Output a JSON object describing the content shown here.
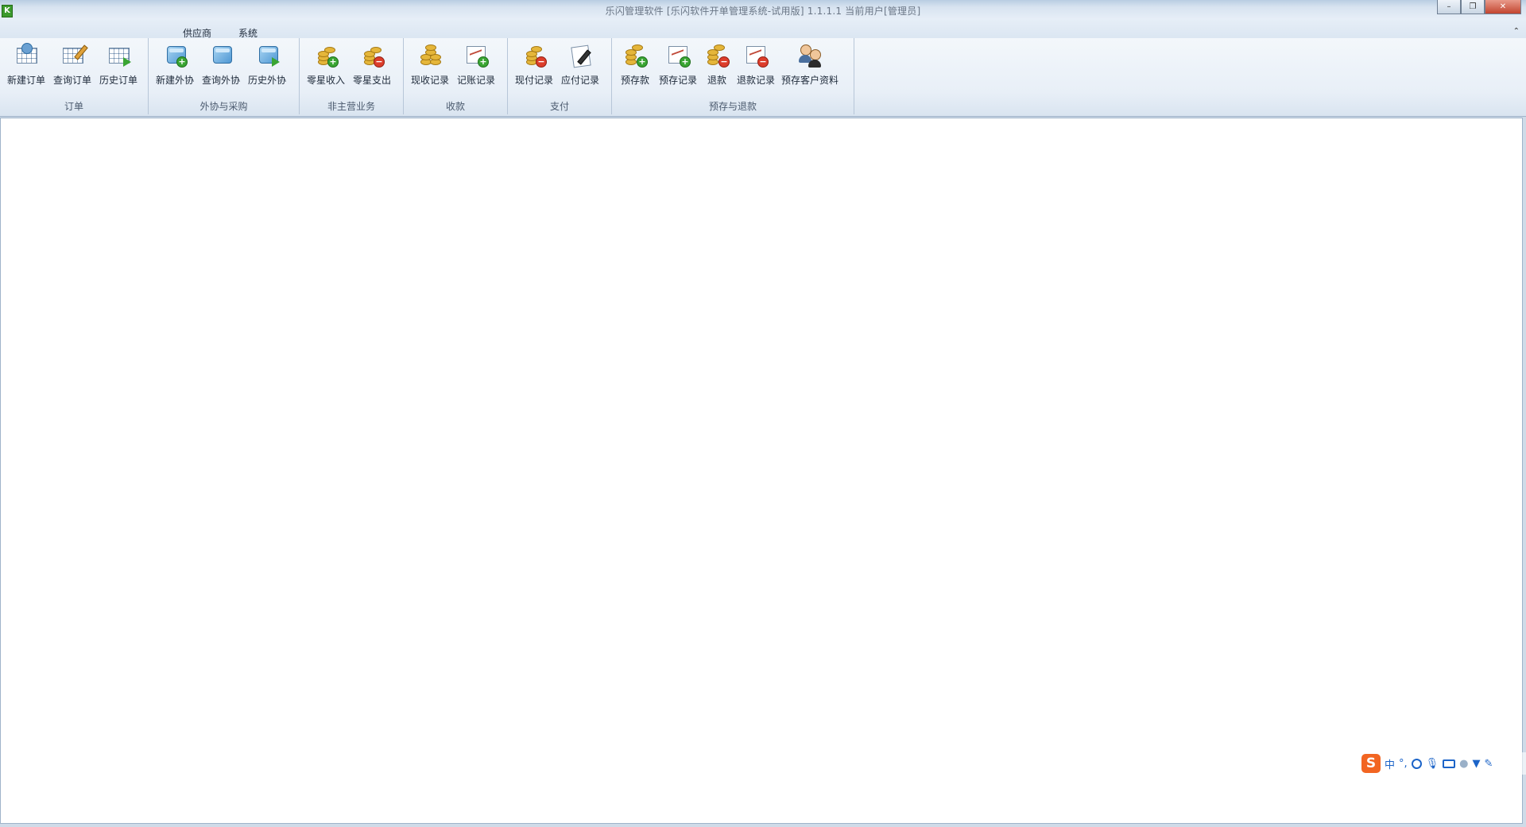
{
  "window": {
    "title": "乐闪管理软件 [乐闪软件开单管理系统-试用版] 1.1.1.1  当前用户[管理员]",
    "logo_letter": "K",
    "controls": {
      "minimize": "–",
      "maximize": "❐",
      "close": "✕"
    }
  },
  "menu": {
    "tabs": [
      {
        "label": "供应商"
      },
      {
        "label": "系统"
      }
    ],
    "collapse_glyph": "⌃"
  },
  "ribbon": {
    "groups": [
      {
        "label": "订单",
        "buttons": [
          {
            "label": "新建订单",
            "icon": "new-order-icon"
          },
          {
            "label": "查询订单",
            "icon": "query-order-icon"
          },
          {
            "label": "历史订单",
            "icon": "history-order-icon"
          }
        ]
      },
      {
        "label": "外协与采购",
        "buttons": [
          {
            "label": "新建外协",
            "icon": "new-outsource-icon"
          },
          {
            "label": "查询外协",
            "icon": "query-outsource-icon"
          },
          {
            "label": "历史外协",
            "icon": "history-outsource-icon"
          }
        ]
      },
      {
        "label": "非主营业务",
        "buttons": [
          {
            "label": "零星收入",
            "icon": "misc-income-icon"
          },
          {
            "label": "零星支出",
            "icon": "misc-expense-icon"
          }
        ]
      },
      {
        "label": "收款",
        "buttons": [
          {
            "label": "现收记录",
            "icon": "cash-receipt-icon"
          },
          {
            "label": "记账记录",
            "icon": "ledger-record-icon"
          }
        ]
      },
      {
        "label": "支付",
        "buttons": [
          {
            "label": "现付记录",
            "icon": "cash-payment-icon"
          },
          {
            "label": "应付记录",
            "icon": "payable-record-icon"
          }
        ]
      },
      {
        "label": "预存与退款",
        "buttons": [
          {
            "label": "预存款",
            "icon": "deposit-icon"
          },
          {
            "label": "预存记录",
            "icon": "deposit-record-icon"
          },
          {
            "label": "退款",
            "icon": "refund-icon"
          },
          {
            "label": "退款记录",
            "icon": "refund-record-icon"
          },
          {
            "label": "预存客户资料",
            "icon": "deposit-customer-icon"
          }
        ]
      }
    ]
  },
  "ime": {
    "logo": "S",
    "mode": "中",
    "punct": "°,"
  }
}
